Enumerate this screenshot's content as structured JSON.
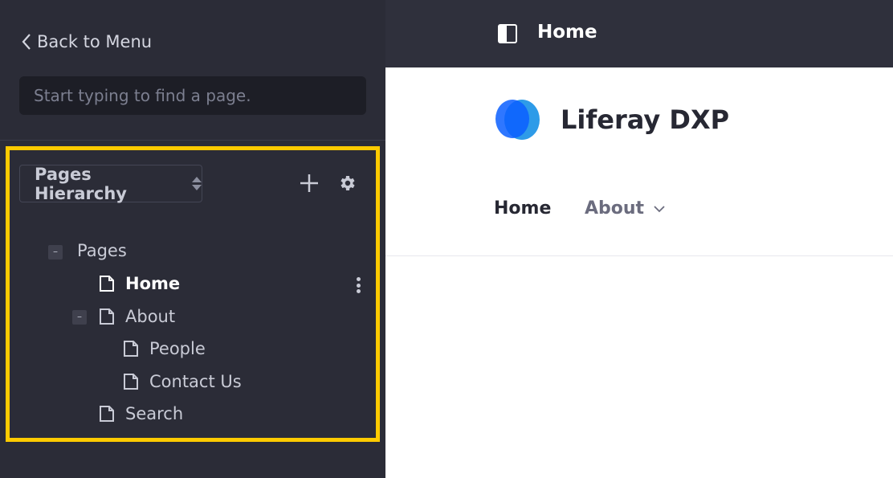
{
  "sidebar": {
    "back_label": "Back to Menu",
    "search_placeholder": "Start typing to find a page.",
    "hierarchy_label": "Pages Hierarchy",
    "tree": {
      "root_label": "Pages",
      "items": [
        {
          "label": "Home",
          "active": true
        },
        {
          "label": "About",
          "expanded": true
        },
        {
          "label": "People"
        },
        {
          "label": "Contact Us"
        },
        {
          "label": "Search"
        }
      ]
    },
    "highlight_color": "#ffcb00"
  },
  "topbar": {
    "title": "Home"
  },
  "site": {
    "name": "Liferay DXP",
    "nav": [
      {
        "label": "Home",
        "active": true
      },
      {
        "label": "About",
        "has_dropdown": true
      }
    ]
  },
  "colors": {
    "sidebar_bg": "#2b2c37",
    "topbar_bg": "#2f303c",
    "logo_primary": "#0b5fff",
    "logo_secondary": "#2e9be8"
  }
}
